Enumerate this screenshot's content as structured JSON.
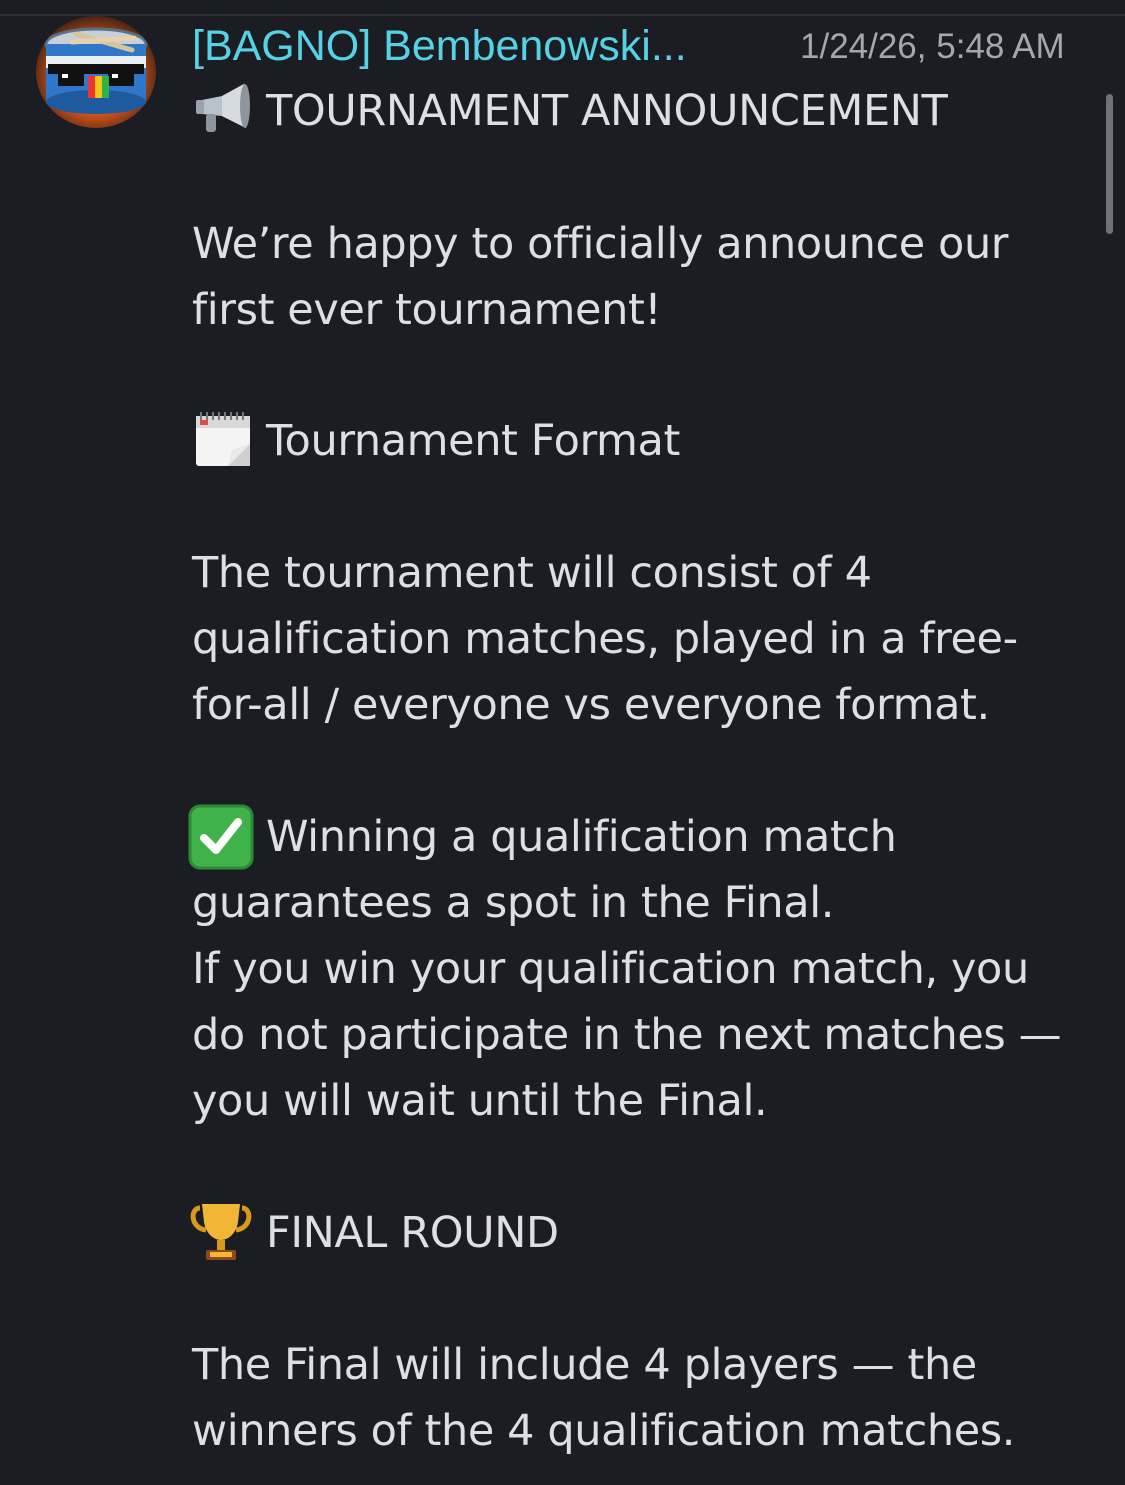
{
  "message": {
    "username": "[BAGNO] Bembenowski...",
    "timestamp": "1/24/26, 5:48 AM",
    "avatar_icon": "drum-with-pixel-sunglasses-icon",
    "lines": {
      "l1": "TOURNAMENT ANNOUNCEMENT",
      "l2": "We’re happy to officially announce our",
      "l3": "first ever tournament!",
      "l4": "Tournament Format",
      "l5": "The tournament will consist of 4",
      "l6": "qualification matches, played in a free-",
      "l7": "for-all / everyone vs everyone format.",
      "l8": "Winning a qualification match",
      "l9": "guarantees a spot in the Final.",
      "l10": "If you win your qualification match, you",
      "l11": "do not participate in the next matches —",
      "l12": "you will wait until the Final.",
      "l13": "FINAL ROUND",
      "l14": "The Final will include 4 players — the",
      "l15": "winners of the 4 qualification matches."
    },
    "emojis": {
      "announcement": "megaphone-icon",
      "format": "calendar-icon",
      "winning": "check-mark-button-icon",
      "final": "trophy-icon"
    }
  },
  "colors": {
    "background": "#1c1d22",
    "username": "#55d2e6",
    "timestamp": "#a5a7af",
    "text": "#dedfe4"
  }
}
